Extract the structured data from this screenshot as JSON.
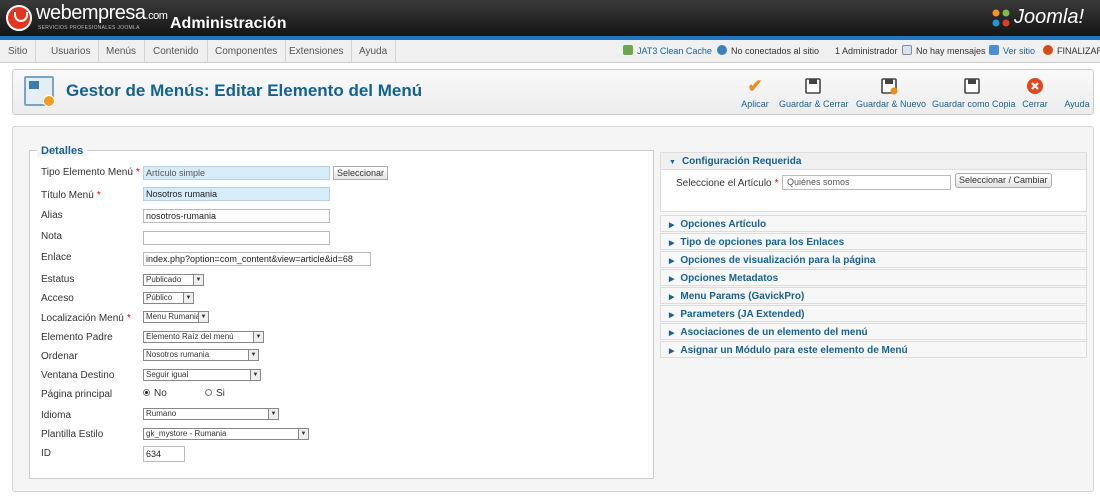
{
  "header": {
    "brand": "webempresa",
    "brand_suffix": ".com",
    "brand_sub": "SERVICIOS PROFESIONALES JOOMLA",
    "admin_title": "Administración",
    "joomla_logo": "Joomla!",
    "stripe_color": "#1d78c1"
  },
  "menu": {
    "items": [
      "Sitio",
      "Usuarios",
      "Menús",
      "Contenido",
      "Componentes",
      "Extensiones",
      "Ayuda"
    ]
  },
  "status": {
    "cache": "JAT3 Clean Cache",
    "site": "No conectados al sitio",
    "admins": "1 Administrador",
    "messages": "No hay mensajes",
    "view_site": "Ver sitio",
    "logout": "FINALIZAR"
  },
  "toolbar": {
    "page_title": "Gestor de Menús: Editar Elemento del Menú",
    "apply": "Aplicar",
    "save_close": "Guardar & Cerrar",
    "save_new": "Guardar & Nuevo",
    "save_copy": "Guardar como Copia",
    "close": "Cerrar",
    "help": "Ayuda"
  },
  "details": {
    "legend": "Detalles",
    "labels": {
      "type": "Tipo Elemento Menú",
      "title": "Título Menú",
      "alias": "Alias",
      "note": "Nota",
      "link": "Enlace",
      "status": "Estatus",
      "access": "Acceso",
      "location": "Localización Menú",
      "parent": "Elemento Padre",
      "order": "Ordenar",
      "target": "Ventana Destino",
      "home": "Página principal",
      "language": "Idioma",
      "template": "Plantilla Estilo",
      "id": "ID"
    },
    "values": {
      "type": "Artículo simple",
      "select_button": "Seleccionar",
      "title": "Nosotros rumania",
      "alias": "nosotros-rumania",
      "note": "",
      "link": "index.php?option=com_content&view=article&id=68",
      "status": "Publicado",
      "access": "Público",
      "location": "Menu Rumania",
      "parent": "Elemento Raíz del menú",
      "order": "Nosotros rumania",
      "target": "Seguir igual",
      "home_no": "No",
      "home_yes": "Si",
      "language": "Rumano",
      "template": "gk_mystore - Rumania",
      "id": "634"
    }
  },
  "sidebar": {
    "required": {
      "title": "Configuración Requerida",
      "article_label": "Seleccione el Artículo",
      "article_value": "Quiénes somos",
      "change_button": "Seleccionar / Cambiar"
    },
    "panels": [
      "Opciones Artículo",
      "Tipo de opciones para los Enlaces",
      "Opciones de visualización para la página",
      "Opciones Metadatos",
      "Menu Params (GavickPro)",
      "Parameters (JA Extended)",
      "Asociaciones de un elemento del menú",
      "Asignar un Módulo para este elemento de Menú"
    ]
  },
  "icons": {
    "brand": "webempresa-logo-icon",
    "joomla": "joomla-logo-icon",
    "cache": "clean-cache-icon",
    "users": "users-icon",
    "messages": "mail-icon",
    "view_site": "monitor-icon",
    "logout": "power-icon",
    "apply": "checkmark-icon",
    "save": "save-icon",
    "close": "close-icon",
    "menu_manager": "menu-manager-icon",
    "caret_down": "caret-down-icon",
    "caret_right": "caret-right-icon"
  },
  "colors": {
    "accent": "#146295",
    "link": "#15649b",
    "required": "#dd0000",
    "close_red": "#e2461f",
    "apply_orange": "#f08c1a"
  }
}
